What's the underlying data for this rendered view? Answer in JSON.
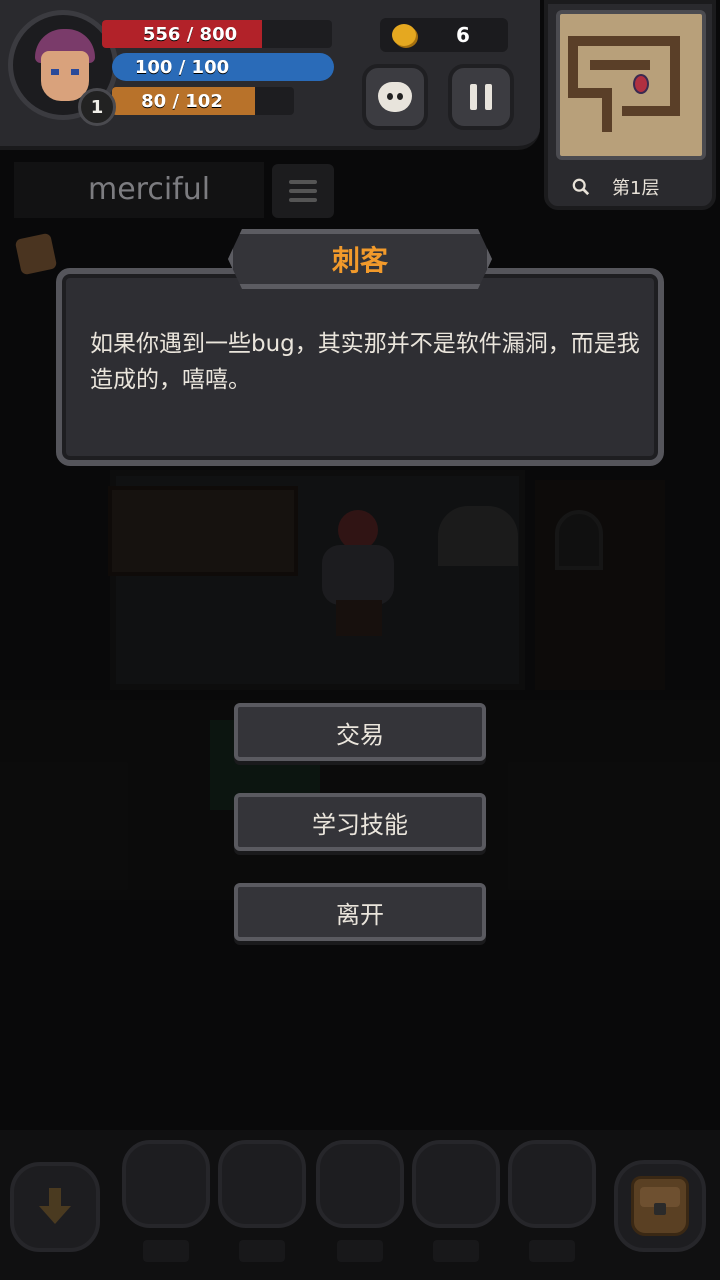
{
  "player": {
    "hp": "556 / 800",
    "hp_fraction": 0.695,
    "mp": "100 / 100",
    "mp_fraction": 1.0,
    "xp": "80 / 102",
    "xp_fraction": 0.784,
    "level": "1"
  },
  "gold": "6",
  "map": {
    "floor": "第1层"
  },
  "difficulty": "merciful",
  "dialog": {
    "speaker": "刺客",
    "text": "如果你遇到一些bug，其实那并不是软件漏洞，而是我造成的，嘻嘻。"
  },
  "options": [
    {
      "label": "交易"
    },
    {
      "label": "学习技能"
    },
    {
      "label": "离开"
    }
  ],
  "colors": {
    "hp": "#b22229",
    "mp": "#2a6bb8",
    "xp": "#b8722a",
    "title": "#f29a2b"
  },
  "icons": {
    "pet": "pet-face-icon",
    "pause": "pause-icon",
    "search": "search-icon",
    "menu": "menu-icon",
    "down": "down-arrow-icon",
    "bag": "backpack-icon"
  }
}
